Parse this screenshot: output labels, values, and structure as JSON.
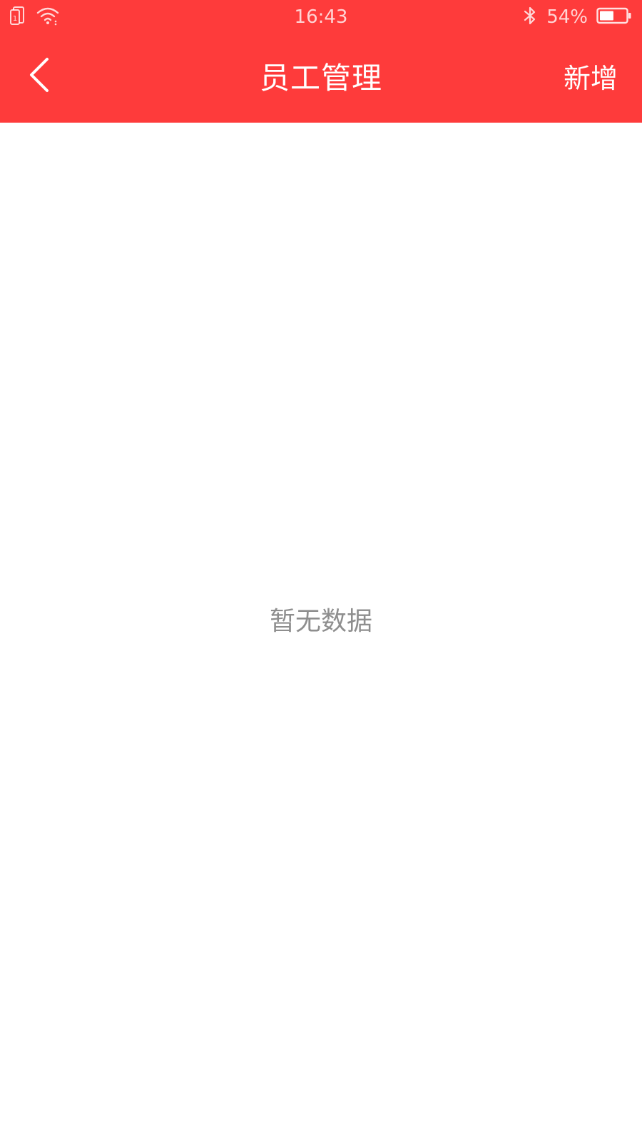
{
  "status_bar": {
    "time": "16:43",
    "battery_percent": "54%",
    "battery_level": 0.54,
    "icons": [
      "sim-icon",
      "wifi-icon",
      "bluetooth-icon",
      "battery-icon"
    ]
  },
  "nav": {
    "title": "员工管理",
    "back_icon": "chevron-left-icon",
    "add_label": "新增"
  },
  "content": {
    "empty_text": "暂无数据"
  },
  "colors": {
    "header": "#fe3b3b",
    "empty_text": "#8e8e8e",
    "background": "#ffffff"
  }
}
